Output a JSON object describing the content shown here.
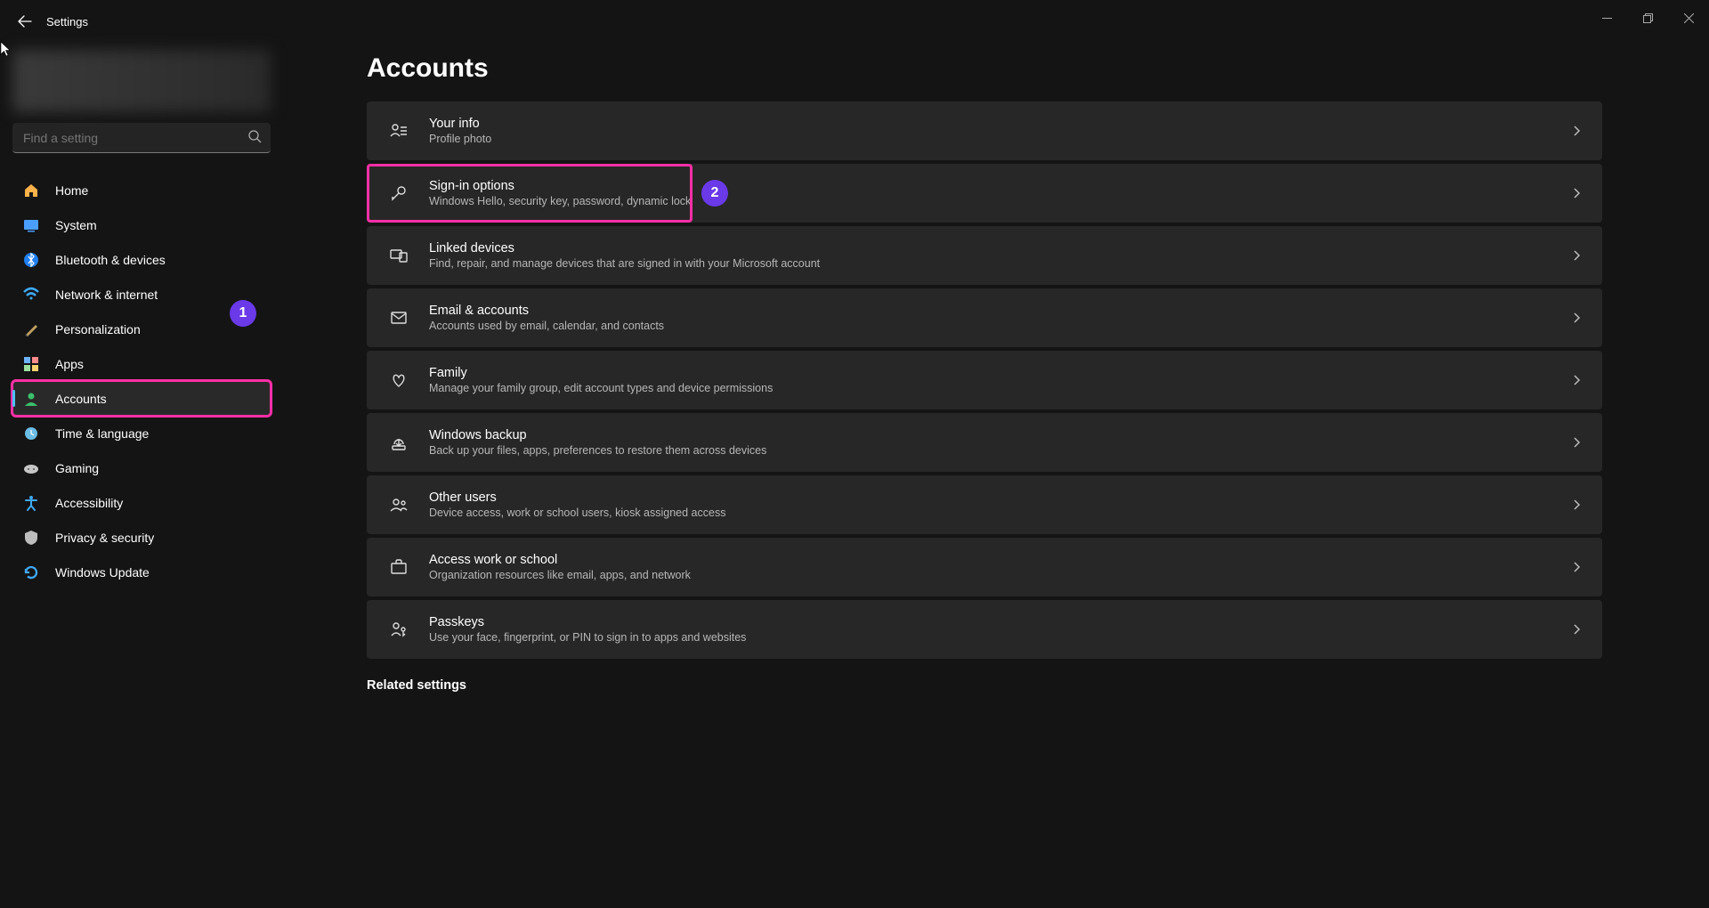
{
  "app": {
    "title": "Settings"
  },
  "search": {
    "placeholder": "Find a setting"
  },
  "page": {
    "title": "Accounts",
    "related_heading": "Related settings"
  },
  "nav": {
    "home": "Home",
    "system": "System",
    "bluetooth": "Bluetooth & devices",
    "network": "Network & internet",
    "personalization": "Personalization",
    "apps": "Apps",
    "accounts": "Accounts",
    "time": "Time & language",
    "gaming": "Gaming",
    "accessibility": "Accessibility",
    "privacy": "Privacy & security",
    "update": "Windows Update"
  },
  "badges": {
    "nav": "1",
    "signin": "2"
  },
  "cards": {
    "your_info": {
      "title": "Your info",
      "sub": "Profile photo"
    },
    "signin": {
      "title": "Sign-in options",
      "sub": "Windows Hello, security key, password, dynamic lock"
    },
    "linked": {
      "title": "Linked devices",
      "sub": "Find, repair, and manage devices that are signed in with your Microsoft account"
    },
    "email": {
      "title": "Email & accounts",
      "sub": "Accounts used by email, calendar, and contacts"
    },
    "family": {
      "title": "Family",
      "sub": "Manage your family group, edit account types and device permissions"
    },
    "backup": {
      "title": "Windows backup",
      "sub": "Back up your files, apps, preferences to restore them across devices"
    },
    "other": {
      "title": "Other users",
      "sub": "Device access, work or school users, kiosk assigned access"
    },
    "work": {
      "title": "Access work or school",
      "sub": "Organization resources like email, apps, and network"
    },
    "passkeys": {
      "title": "Passkeys",
      "sub": "Use your face, fingerprint, or PIN to sign in to apps and websites"
    }
  }
}
